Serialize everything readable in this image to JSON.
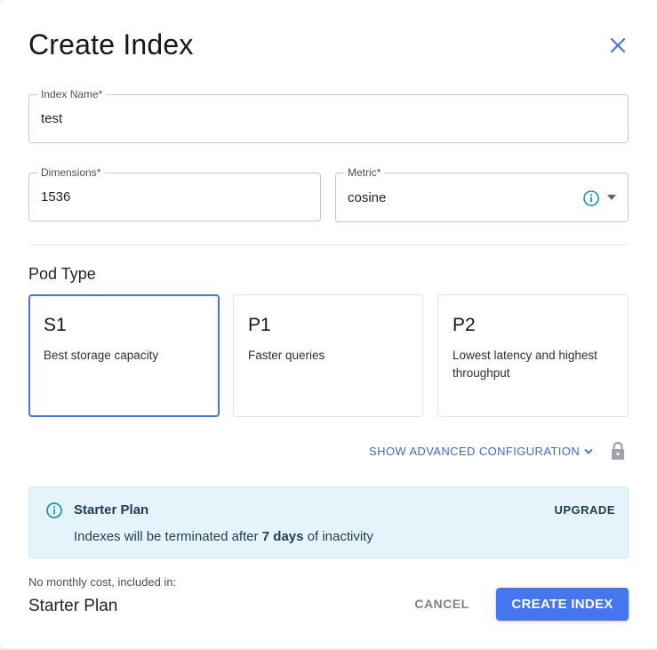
{
  "dialog": {
    "title": "Create Index"
  },
  "fields": {
    "index_name": {
      "label": "Index Name",
      "required_mark": "*",
      "value": "test"
    },
    "dimensions": {
      "label": "Dimensions",
      "required_mark": "*",
      "value": "1536"
    },
    "metric": {
      "label": "Metric",
      "required_mark": "*",
      "value": "cosine"
    }
  },
  "pod_type": {
    "title": "Pod Type",
    "selected": "S1",
    "options": [
      {
        "name": "S1",
        "description": "Best storage capacity"
      },
      {
        "name": "P1",
        "description": "Faster queries"
      },
      {
        "name": "P2",
        "description": "Lowest latency and highest throughput"
      }
    ]
  },
  "advanced": {
    "label": "SHOW ADVANCED CONFIGURATION"
  },
  "banner": {
    "title": "Starter Plan",
    "action": "UPGRADE",
    "text_before": "Indexes will be terminated after ",
    "text_bold": "7 days",
    "text_after": " of inactivity"
  },
  "footer": {
    "cost_label": "No monthly cost, included in:",
    "plan_name": "Starter Plan",
    "cancel_label": "CANCEL",
    "create_label": "CREATE INDEX"
  },
  "colors": {
    "primary": "#4575ef",
    "link": "#3c68d6",
    "info_icon": "#1a8fc4",
    "banner_bg": "#e5f4fb"
  }
}
